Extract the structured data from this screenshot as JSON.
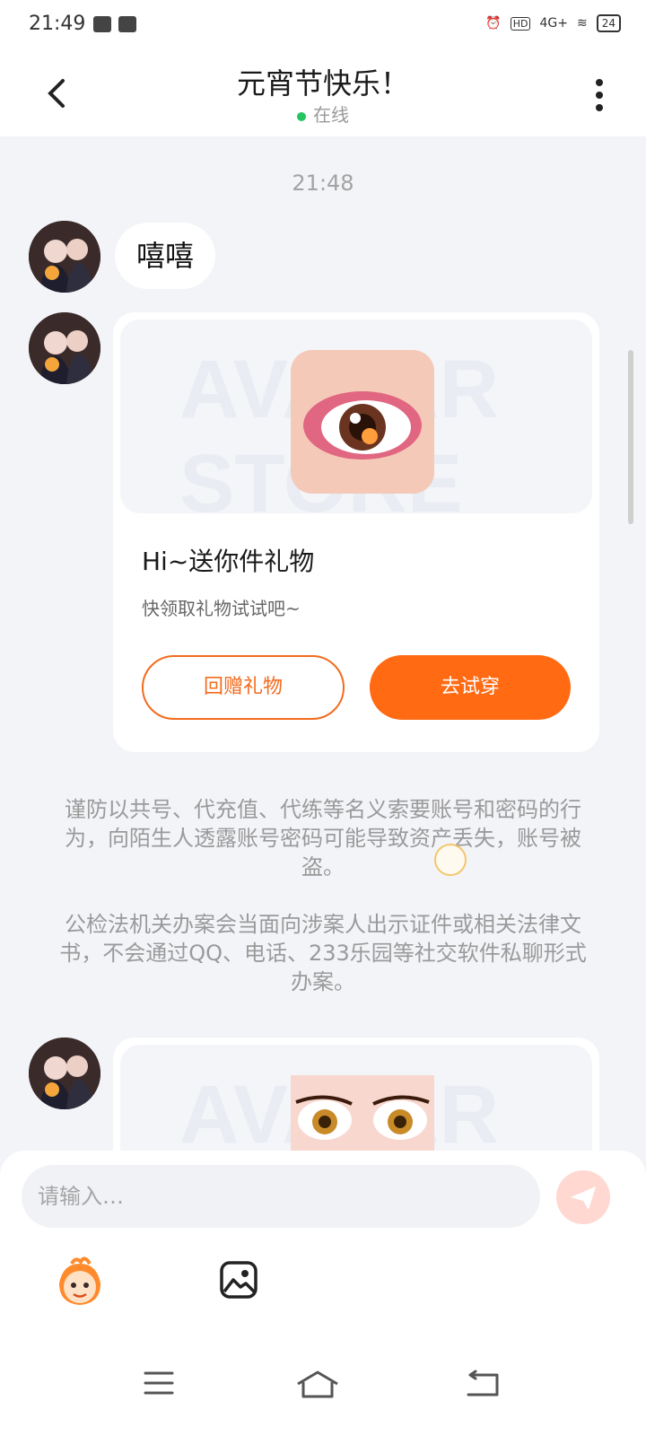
{
  "status": {
    "time": "21:49",
    "battery": "24",
    "network": "4G+"
  },
  "chat": {
    "title": "元宵节快乐！",
    "online_label": "在线"
  },
  "messages": {
    "time": "21:48",
    "bubble_text": "嘻嘻",
    "gift_card": {
      "watermark": "AVATAR STORE",
      "title": "Hi~送你件礼物",
      "subtitle": "快领取礼物试试吧~",
      "return_button": "回赠礼物",
      "try_button": "去试穿"
    },
    "notice1": "谨防以共号、代充值、代练等名义索要账号和密码的行为，向陌生人透露账号密码可能导致资产丢失，账号被盗。",
    "notice2": "公检法机关办案会当面向涉案人出示证件或相关法律文书，不会通过QQ、电话、233乐园等社交软件私聊形式办案。"
  },
  "input": {
    "placeholder": "请输入…"
  },
  "colors": {
    "accent": "#ff6a13",
    "background": "#f3f4f8"
  },
  "icons": {
    "back": "back-icon",
    "more": "more-icon",
    "send": "send-icon",
    "image": "image-icon",
    "menu": "menu-icon",
    "home": "home-icon",
    "back_nav": "back-nav-icon"
  }
}
